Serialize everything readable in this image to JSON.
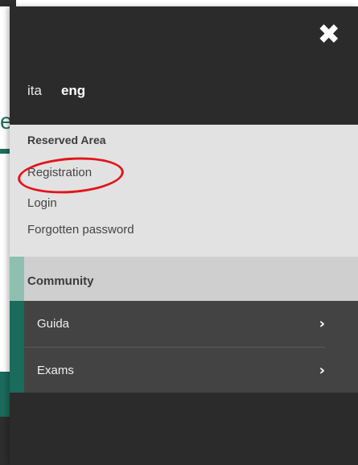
{
  "background": {
    "partial_heading": "er"
  },
  "panel": {
    "close_icon": "✖",
    "languages": [
      {
        "label": "ita",
        "active": false
      },
      {
        "label": "eng",
        "active": true
      }
    ],
    "reserved_area": {
      "title": "Reserved Area",
      "links": [
        "Registration",
        "Login",
        "Forgotten password"
      ]
    },
    "community": {
      "title": "Community"
    },
    "menu": [
      {
        "label": "Guida",
        "chevron": "›"
      },
      {
        "label": "Exams",
        "chevron": "›"
      }
    ]
  },
  "colors": {
    "panel_bg": "#2b2b2b",
    "reserved_bg": "#e2e2e2",
    "community_bg": "#cfcfcf",
    "menu_bg": "#434343",
    "accent_green": "#1a6b5b",
    "highlight_red": "#e3141b"
  }
}
